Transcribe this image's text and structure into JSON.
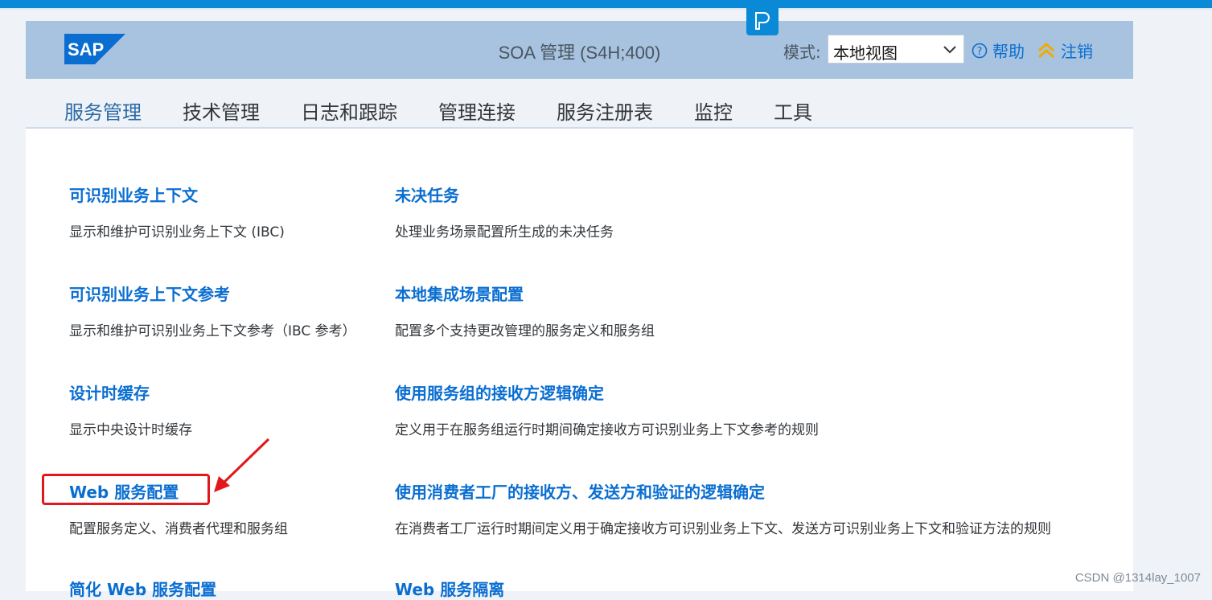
{
  "header": {
    "logo_text": "SAP",
    "title": "SOA 管理 (S4H;400)",
    "mode_label": "模式:",
    "mode_value": "本地视图",
    "help_label": "帮助",
    "logout_label": "注销"
  },
  "tabs": [
    {
      "label": "服务管理",
      "active": true
    },
    {
      "label": "技术管理",
      "active": false
    },
    {
      "label": "日志和跟踪",
      "active": false
    },
    {
      "label": "管理连接",
      "active": false
    },
    {
      "label": "服务注册表",
      "active": false
    },
    {
      "label": "监控",
      "active": false
    },
    {
      "label": "工具",
      "active": false
    }
  ],
  "left_items": [
    {
      "title": "可识别业务上下文",
      "desc": "显示和维护可识别业务上下文 (IBC)"
    },
    {
      "title": "可识别业务上下文参考",
      "desc": "显示和维护可识别业务上下文参考（IBC 参考）"
    },
    {
      "title": "设计时缓存",
      "desc": "显示中央设计时缓存"
    },
    {
      "title": "Web 服务配置",
      "desc": "配置服务定义、消费者代理和服务组"
    },
    {
      "title": "简化 Web 服务配置",
      "desc": ""
    }
  ],
  "right_items": [
    {
      "title": "未决任务",
      "desc": "处理业务场景配置所生成的未决任务"
    },
    {
      "title": "本地集成场景配置",
      "desc": "配置多个支持更改管理的服务定义和服务组"
    },
    {
      "title": "使用服务组的接收方逻辑确定",
      "desc": "定义用于在服务组运行时期间确定接收方可识别业务上下文参考的规则"
    },
    {
      "title": "使用消费者工厂的接收方、发送方和验证的逻辑确定",
      "desc": "在消费者工厂运行时期间定义用于确定接收方可识别业务上下文、发送方可识别业务上下文和验证方法的规则"
    },
    {
      "title": "Web 服务隔离",
      "desc": ""
    }
  ],
  "watermark": "CSDN @1314lay_1007",
  "colors": {
    "brand_blue": "#0a6ed1",
    "header_bg": "#a8c3df",
    "highlight": "#e3161b"
  }
}
